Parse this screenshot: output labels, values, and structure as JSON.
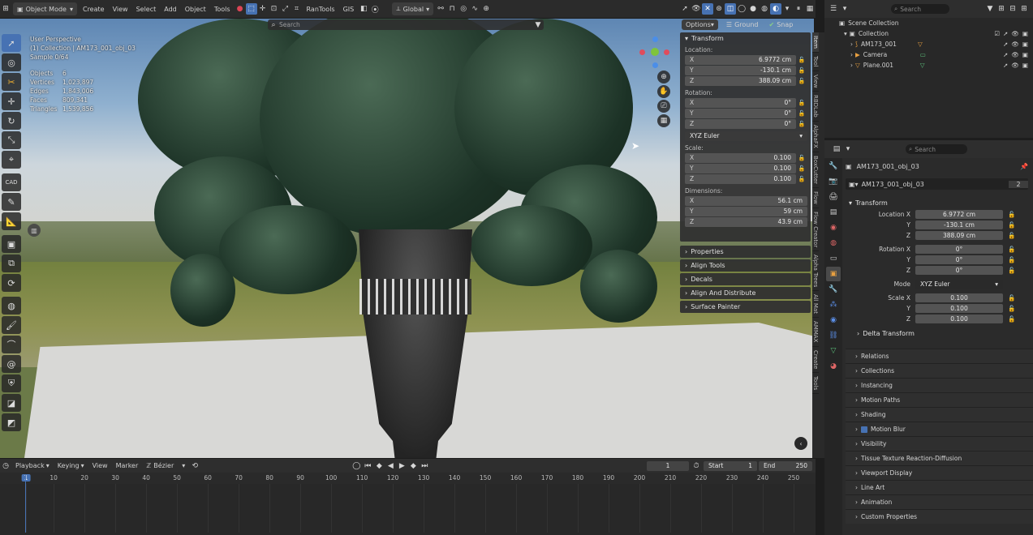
{
  "header": {
    "mode": "Object Mode",
    "menus": [
      "Create",
      "View",
      "Select",
      "Add",
      "Object",
      "Tools"
    ],
    "addon": "RanTools",
    "gis": "GIS",
    "orientation": "Global",
    "search_placeholder": "Search",
    "options": "Options",
    "ground": "Ground",
    "snap": "Snap"
  },
  "viewport": {
    "perspective": "User Perspective",
    "collection_line": "(1) Collection | AM173_001_obj_03",
    "sample": "Sample 0/64",
    "stats": [
      {
        "label": "Objects",
        "value": "6"
      },
      {
        "label": "Vertices",
        "value": "1,023,897"
      },
      {
        "label": "Edges",
        "value": "1,843,006"
      },
      {
        "label": "Faces",
        "value": "809,341"
      },
      {
        "label": "Triangles",
        "value": "1,539,856"
      }
    ],
    "tool_cad": "CAD"
  },
  "npanel": {
    "transform": "Transform",
    "location_label": "Location:",
    "location": [
      {
        "ax": "X",
        "v": "6.9772 cm"
      },
      {
        "ax": "Y",
        "v": "-130.1 cm"
      },
      {
        "ax": "Z",
        "v": "388.09 cm"
      }
    ],
    "rotation_label": "Rotation:",
    "rotation": [
      {
        "ax": "X",
        "v": "0°"
      },
      {
        "ax": "Y",
        "v": "0°"
      },
      {
        "ax": "Z",
        "v": "0°"
      }
    ],
    "rot_mode": "XYZ Euler",
    "scale_label": "Scale:",
    "scale": [
      {
        "ax": "X",
        "v": "0.100"
      },
      {
        "ax": "Y",
        "v": "0.100"
      },
      {
        "ax": "Z",
        "v": "0.100"
      }
    ],
    "dimensions_label": "Dimensions:",
    "dimensions": [
      {
        "ax": "X",
        "v": "56.1 cm"
      },
      {
        "ax": "Y",
        "v": "59 cm"
      },
      {
        "ax": "Z",
        "v": "43.9 cm"
      }
    ],
    "subpanels": [
      "Properties",
      "Align Tools",
      "Decals",
      "Align And Distribute",
      "Surface Painter"
    ]
  },
  "vtabs": [
    "Item",
    "Tool",
    "View",
    "RBDLab",
    "AlphaFX",
    "BoxCutter",
    "Flow",
    "Flow Creator",
    "Alpha Trees",
    "All Mat",
    "AMMAX",
    "Create",
    "Tools"
  ],
  "timeline": {
    "playback": "Playback",
    "keying": "Keying",
    "view": "View",
    "marker": "Marker",
    "interp": "Bézier",
    "current": "1",
    "start_label": "Start",
    "start": "1",
    "end_label": "End",
    "end": "250",
    "ticks": [
      "1",
      "10",
      "20",
      "30",
      "40",
      "50",
      "60",
      "70",
      "80",
      "90",
      "100",
      "110",
      "120",
      "130",
      "140",
      "150",
      "160",
      "170",
      "180",
      "190",
      "200",
      "210",
      "220",
      "230",
      "240",
      "250"
    ]
  },
  "outliner": {
    "search_placeholder": "Search",
    "scene": "Scene Collection",
    "collection": "Collection",
    "items": [
      "AM173_001",
      "Camera",
      "Plane.001"
    ]
  },
  "properties": {
    "search_placeholder": "Search",
    "object_name": "AM173_001_obj_03",
    "data_name": "AM173_001_obj_03",
    "users": "2",
    "transform": "Transform",
    "location": [
      {
        "l": "Location X",
        "v": "6.9772 cm"
      },
      {
        "l": "Y",
        "v": "-130.1 cm"
      },
      {
        "l": "Z",
        "v": "388.09 cm"
      }
    ],
    "rotation": [
      {
        "l": "Rotation X",
        "v": "0°"
      },
      {
        "l": "Y",
        "v": "0°"
      },
      {
        "l": "Z",
        "v": "0°"
      }
    ],
    "mode_label": "Mode",
    "mode": "XYZ Euler",
    "scale": [
      {
        "l": "Scale X",
        "v": "0.100"
      },
      {
        "l": "Y",
        "v": "0.100"
      },
      {
        "l": "Z",
        "v": "0.100"
      }
    ],
    "delta": "Delta Transform",
    "sections": [
      "Relations",
      "Collections",
      "Instancing",
      "Motion Paths",
      "Shading",
      "Motion Blur",
      "Visibility",
      "Tissue Texture Reaction-Diffusion",
      "Viewport Display",
      "Line Art",
      "Animation",
      "Custom Properties"
    ]
  },
  "colors": {
    "accent": "#4772b3",
    "panel": "#303030",
    "field": "#545454"
  }
}
